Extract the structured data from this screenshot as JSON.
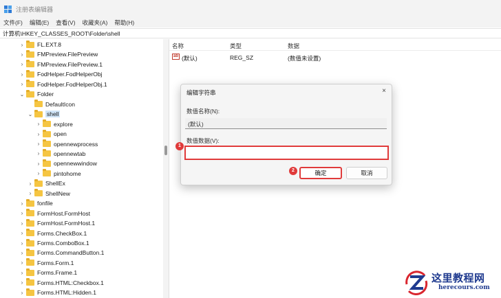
{
  "window": {
    "title": "注册表编辑器"
  },
  "menu": [
    "文件(F)",
    "编辑(E)",
    "查看(V)",
    "收藏夹(A)",
    "帮助(H)"
  ],
  "address": "计算机\\HKEY_CLASSES_ROOT\\Folder\\shell",
  "tree": [
    {
      "label": "FL.EXT.8",
      "level": 0,
      "state": "collapsed"
    },
    {
      "label": "FMPreview.FilePreview",
      "level": 0,
      "state": "collapsed"
    },
    {
      "label": "FMPreview.FilePreview.1",
      "level": 0,
      "state": "collapsed"
    },
    {
      "label": "FodHelper.FodHelperObj",
      "level": 0,
      "state": "collapsed"
    },
    {
      "label": "FodHelper.FodHelperObj.1",
      "level": 0,
      "state": "collapsed"
    },
    {
      "label": "Folder",
      "level": 0,
      "state": "expanded"
    },
    {
      "label": "DefaultIcon",
      "level": 1,
      "state": "leaf"
    },
    {
      "label": "shell",
      "level": 1,
      "state": "expanded",
      "selected": true
    },
    {
      "label": "explore",
      "level": 2,
      "state": "collapsed"
    },
    {
      "label": "open",
      "level": 2,
      "state": "collapsed"
    },
    {
      "label": "opennewprocess",
      "level": 2,
      "state": "collapsed"
    },
    {
      "label": "opennewtab",
      "level": 2,
      "state": "collapsed"
    },
    {
      "label": "opennewwindow",
      "level": 2,
      "state": "collapsed"
    },
    {
      "label": "pintohome",
      "level": 2,
      "state": "collapsed"
    },
    {
      "label": "ShellEx",
      "level": 1,
      "state": "collapsed"
    },
    {
      "label": "ShellNew",
      "level": 1,
      "state": "collapsed"
    },
    {
      "label": "fonfile",
      "level": 0,
      "state": "collapsed"
    },
    {
      "label": "FormHost.FormHost",
      "level": 0,
      "state": "collapsed"
    },
    {
      "label": "FormHost.FormHost.1",
      "level": 0,
      "state": "collapsed"
    },
    {
      "label": "Forms.CheckBox.1",
      "level": 0,
      "state": "collapsed"
    },
    {
      "label": "Forms.ComboBox.1",
      "level": 0,
      "state": "collapsed"
    },
    {
      "label": "Forms.CommandButton.1",
      "level": 0,
      "state": "collapsed"
    },
    {
      "label": "Forms.Form.1",
      "level": 0,
      "state": "collapsed"
    },
    {
      "label": "Forms.Frame.1",
      "level": 0,
      "state": "collapsed"
    },
    {
      "label": "Forms.HTML:Checkbox.1",
      "level": 0,
      "state": "collapsed"
    },
    {
      "label": "Forms.HTML:Hidden.1",
      "level": 0,
      "state": "collapsed"
    }
  ],
  "list": {
    "headers": {
      "name": "名称",
      "type": "类型",
      "data": "数据"
    },
    "rows": [
      {
        "name": "(默认)",
        "type": "REG_SZ",
        "data": "(数值未设置)",
        "icon": "ab"
      }
    ]
  },
  "dialog": {
    "title": "编辑字符串",
    "name_label": "数值名称(N):",
    "name_value": "(默认)",
    "value_label": "数值数据(V):",
    "value_value": "",
    "ok_label": "确定",
    "cancel_label": "取消",
    "close_glyph": "×",
    "step1": "1",
    "step2": "2",
    "highlight_color": "#e03a3a"
  },
  "watermark": {
    "cn": "这里教程网",
    "en": "herecours.com"
  }
}
